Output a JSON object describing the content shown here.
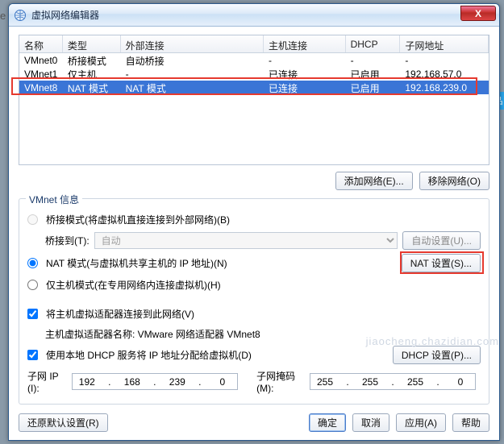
{
  "edge_letter": "e",
  "sidetab": "品",
  "window": {
    "title": "虚拟网络编辑器",
    "close": "X"
  },
  "grid": {
    "headers": {
      "c0": "名称",
      "c1": "类型",
      "c2": "外部连接",
      "c3": "主机连接",
      "c4": "DHCP",
      "c5": "子网地址"
    },
    "rows": [
      {
        "c0": "VMnet0",
        "c1": "桥接模式",
        "c2": "自动桥接",
        "c3": "-",
        "c4": "-",
        "c5": "-"
      },
      {
        "c0": "VMnet1",
        "c1": "仅主机",
        "c2": "-",
        "c3": "已连接",
        "c4": "已启用",
        "c5": "192.168.57.0"
      },
      {
        "c0": "VMnet8",
        "c1": "NAT 模式",
        "c2": "NAT 模式",
        "c3": "已连接",
        "c4": "已启用",
        "c5": "192.168.239.0"
      }
    ]
  },
  "buttons": {
    "add_net": "添加网络(E)...",
    "remove_net": "移除网络(O)"
  },
  "info": {
    "legend": "VMnet 信息",
    "bridge_radio": "桥接模式(将虚拟机直接连接到外部网络)(B)",
    "bridge_to": "桥接到(T):",
    "bridge_sel": "自动",
    "auto_set": "自动设置(U)...",
    "nat_radio": "NAT 模式(与虚拟机共享主机的 IP 地址)(N)",
    "nat_set": "NAT 设置(S)...",
    "host_radio": "仅主机模式(在专用网络内连接虚拟机)(H)",
    "connect_host": "将主机虚拟适配器连接到此网络(V)",
    "adapter_label": "主机虚拟适配器名称: VMware 网络适配器 VMnet8",
    "use_dhcp": "使用本地 DHCP 服务将 IP 地址分配给虚拟机(D)",
    "dhcp_set": "DHCP 设置(P)...",
    "subnet_ip_label": "子网 IP (I):",
    "subnet_ip": {
      "a": "192",
      "b": "168",
      "c": "239",
      "d": "0"
    },
    "mask_label": "子网掩码(M):",
    "mask": {
      "a": "255",
      "b": "255",
      "c": "255",
      "d": "0"
    }
  },
  "bottom": {
    "restore": "还原默认设置(R)",
    "ok": "确定",
    "cancel": "取消",
    "apply": "应用(A)",
    "help": "帮助"
  },
  "watermark": "jiaocheng.chazidian.com"
}
